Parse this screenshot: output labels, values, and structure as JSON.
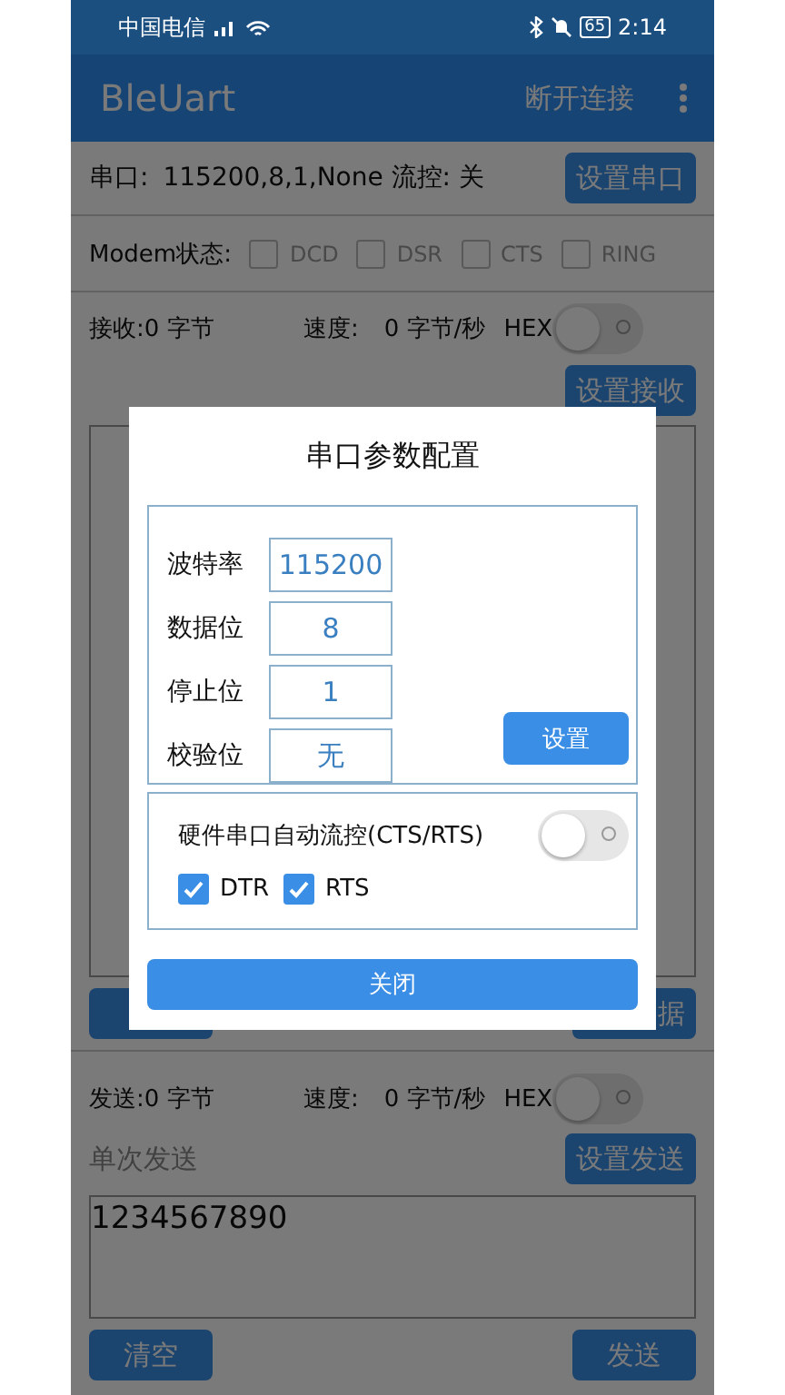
{
  "status_bar": {
    "carrier": "中国电信",
    "battery": "65",
    "time": "2:14"
  },
  "app_bar": {
    "title": "BleUart",
    "action": "断开连接"
  },
  "serial": {
    "label": "串口:",
    "value": "115200,8,1,None 流控: 关",
    "button": "设置串口"
  },
  "modem": {
    "label": "Modem状态:",
    "signals": [
      {
        "label": "DCD",
        "checked": false
      },
      {
        "label": "DSR",
        "checked": false
      },
      {
        "label": "CTS",
        "checked": false
      },
      {
        "label": "RING",
        "checked": false
      }
    ]
  },
  "receive": {
    "count": "接收:0 字节",
    "speed_label": "速度:",
    "speed": "0 字节/秒",
    "hex_label": "HEX",
    "hex_on": false,
    "button": "设置接收",
    "right_button": "据"
  },
  "send": {
    "count": "发送:0 字节",
    "speed_label": "速度:",
    "speed": "0 字节/秒",
    "hex_label": "HEX",
    "hex_on": false,
    "mode": "单次发送",
    "settings_button": "设置发送",
    "value": "1234567890",
    "clear_button": "清空",
    "send_button": "发送"
  },
  "dialog": {
    "title": "串口参数配置",
    "fields": [
      {
        "label": "波特率",
        "value": "115200"
      },
      {
        "label": "数据位",
        "value": "8"
      },
      {
        "label": "停止位",
        "value": "1"
      },
      {
        "label": "校验位",
        "value": "无"
      }
    ],
    "set_button": "设置",
    "flow_control": {
      "label": "硬件串口自动流控(CTS/RTS)",
      "on": false
    },
    "lines": [
      {
        "label": "DTR",
        "checked": true
      },
      {
        "label": "RTS",
        "checked": true
      }
    ],
    "close_button": "关闭"
  }
}
